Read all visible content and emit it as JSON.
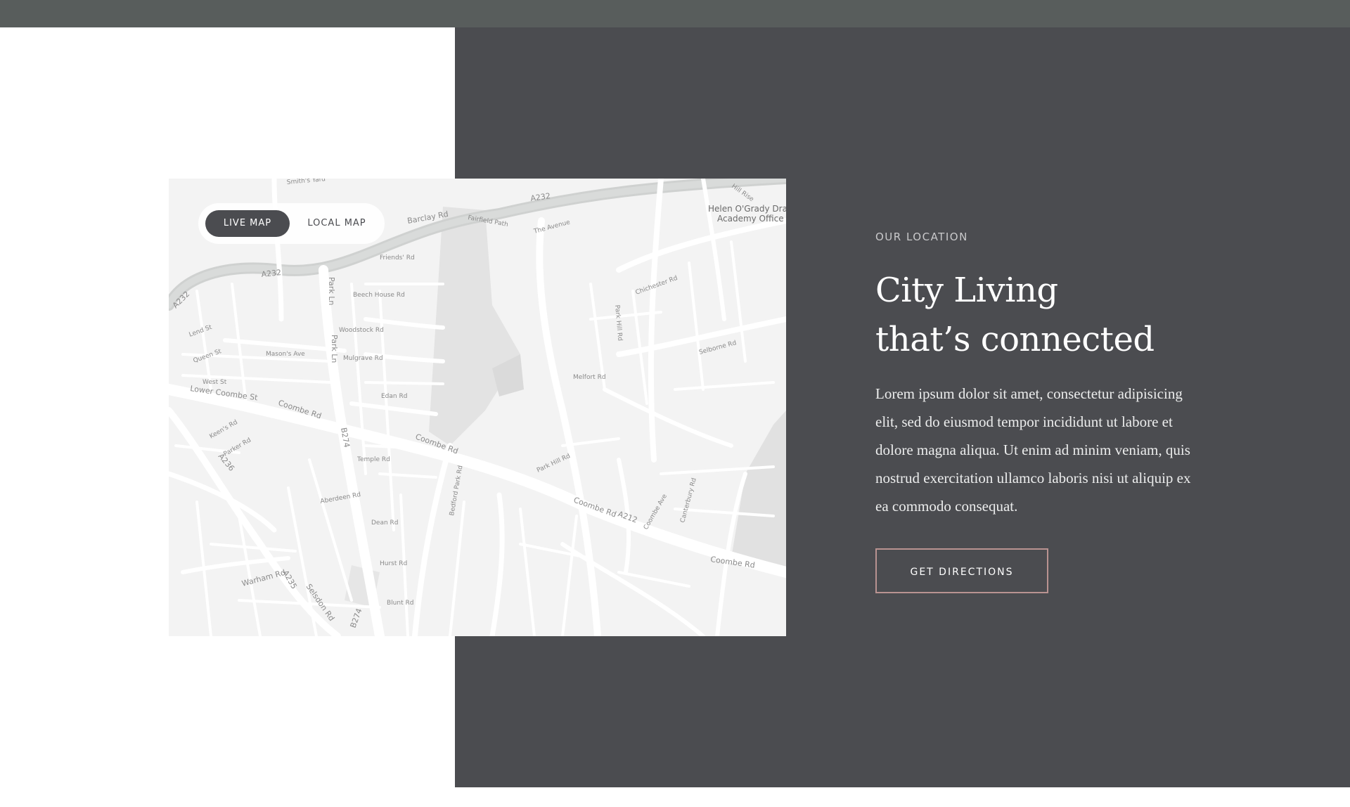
{
  "colors": {
    "top_bar": "#585d5c",
    "panel": "#4b4c50",
    "map_background": "#f3f3f3",
    "button_border": "#b99391"
  },
  "map": {
    "tabs": {
      "live": "LIVE MAP",
      "local": "LOCAL MAP"
    },
    "active_tab": "live",
    "labels": {
      "a232_top": "A232",
      "a232_left": "A232",
      "a232_corner": "A232",
      "barclay": "Barclay Rd",
      "fairfield": "Fairfield Path",
      "the_avenue": "The Avenue",
      "helen_1": "Helen O'Grady Drama",
      "helen_2": "Academy Office",
      "friends": "Friends' Rd",
      "park_ln": "Park Ln",
      "park_ln_2": "Park Ln",
      "beech": "Beech House Rd",
      "woodstock": "Woodstock Rd",
      "mulgrave": "Mulgrave Rd",
      "lower_coombe": "Lower Coombe St",
      "coombe_rd_1": "Coombe Rd",
      "coombe_rd_2": "Coombe Rd",
      "coombe_rd_3": "Coombe Rd",
      "coombe_rd_4": "Coombe Rd",
      "b274": "B274",
      "b274_2": "B274",
      "a212": "A212",
      "a236": "A236",
      "a235": "A235",
      "chichester": "Chichester Rd",
      "selborne": "Selborne Rd",
      "park_hill": "Park Hill Rd",
      "warham": "Warham Rd",
      "selsdon": "Selsdon Rd",
      "temple": "Temple Rd",
      "edan": "Edan Rd",
      "dean": "Dean Rd",
      "hurst": "Hurst Rd",
      "blunt": "Blunt Rd",
      "masons": "Mason's Ave",
      "west_st": "West St",
      "queen_st": "Queen St",
      "lend_st": "Lend St",
      "keens": "Keen's Rd",
      "parker": "Parker Rd",
      "park_hill_2": "Park Hill Rd",
      "coombe_ave": "Coombe Ave",
      "canterbury": "Canterbury Rd",
      "melfort": "Melfort Rd",
      "smiths_yard": "Smith's Yard",
      "hill_rise": "Hill Rise",
      "bedford": "Bedford Park Rd",
      "aberdeen": "Aberdeen Rd"
    }
  },
  "section": {
    "eyebrow": "OUR LOCATION",
    "headline_line1": "City Living",
    "headline_line2": "that’s connected",
    "body": "Lorem ipsum dolor sit amet, consectetur adipisicing elit, sed do eiusmod tempor incididunt ut labore et dolore magna aliqua. Ut enim ad minim veniam, quis nostrud exercitation ullamco laboris nisi ut aliquip ex ea commodo consequat.",
    "cta": "GET DIRECTIONS"
  }
}
